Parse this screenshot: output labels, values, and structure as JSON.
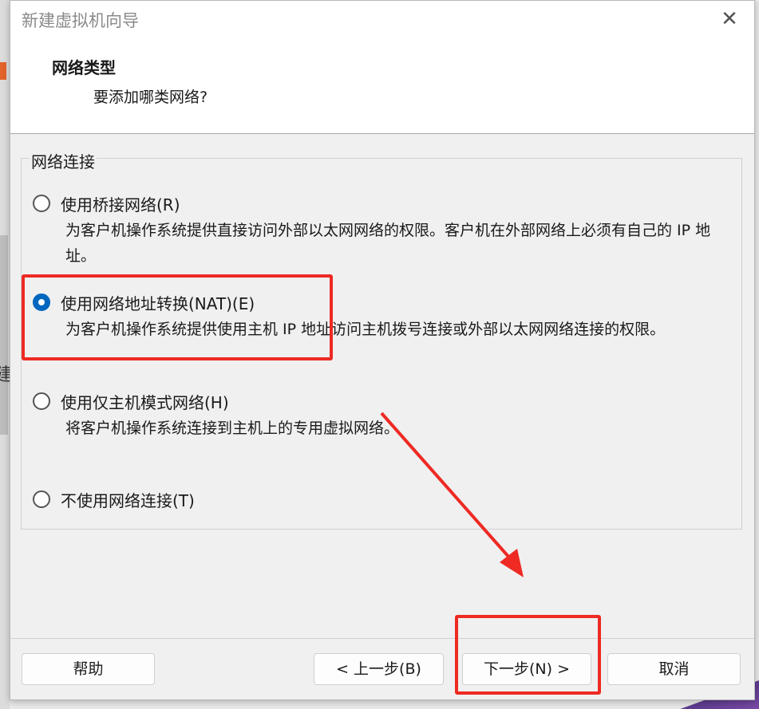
{
  "window": {
    "title": "新建虚拟机向导",
    "close_glyph": "✕"
  },
  "header": {
    "title": "网络类型",
    "subtitle": "要添加哪类网络?"
  },
  "group": {
    "label": "网络连接"
  },
  "options": [
    {
      "label": "使用桥接网络(R)",
      "desc": "为客户机操作系统提供直接访问外部以太网网络的权限。客户机在外部网络上必须有自己的 IP 地址。",
      "checked": false
    },
    {
      "label": "使用网络地址转换(NAT)(E)",
      "desc": "为客户机操作系统提供使用主机 IP 地址访问主机拨号连接或外部以太网网络连接的权限。",
      "checked": true
    },
    {
      "label": "使用仅主机模式网络(H)",
      "desc": "将客户机操作系统连接到主机上的专用虚拟网络。",
      "checked": false
    },
    {
      "label": "不使用网络连接(T)",
      "desc": "",
      "checked": false
    }
  ],
  "buttons": {
    "help": "帮助",
    "back": "< 上一步(B)",
    "next": "下一步(N) >",
    "cancel": "取消"
  },
  "background": {
    "left_char": "建"
  },
  "colors": {
    "annotation_red": "#ee2a23",
    "radio_accent": "#0067c0"
  }
}
